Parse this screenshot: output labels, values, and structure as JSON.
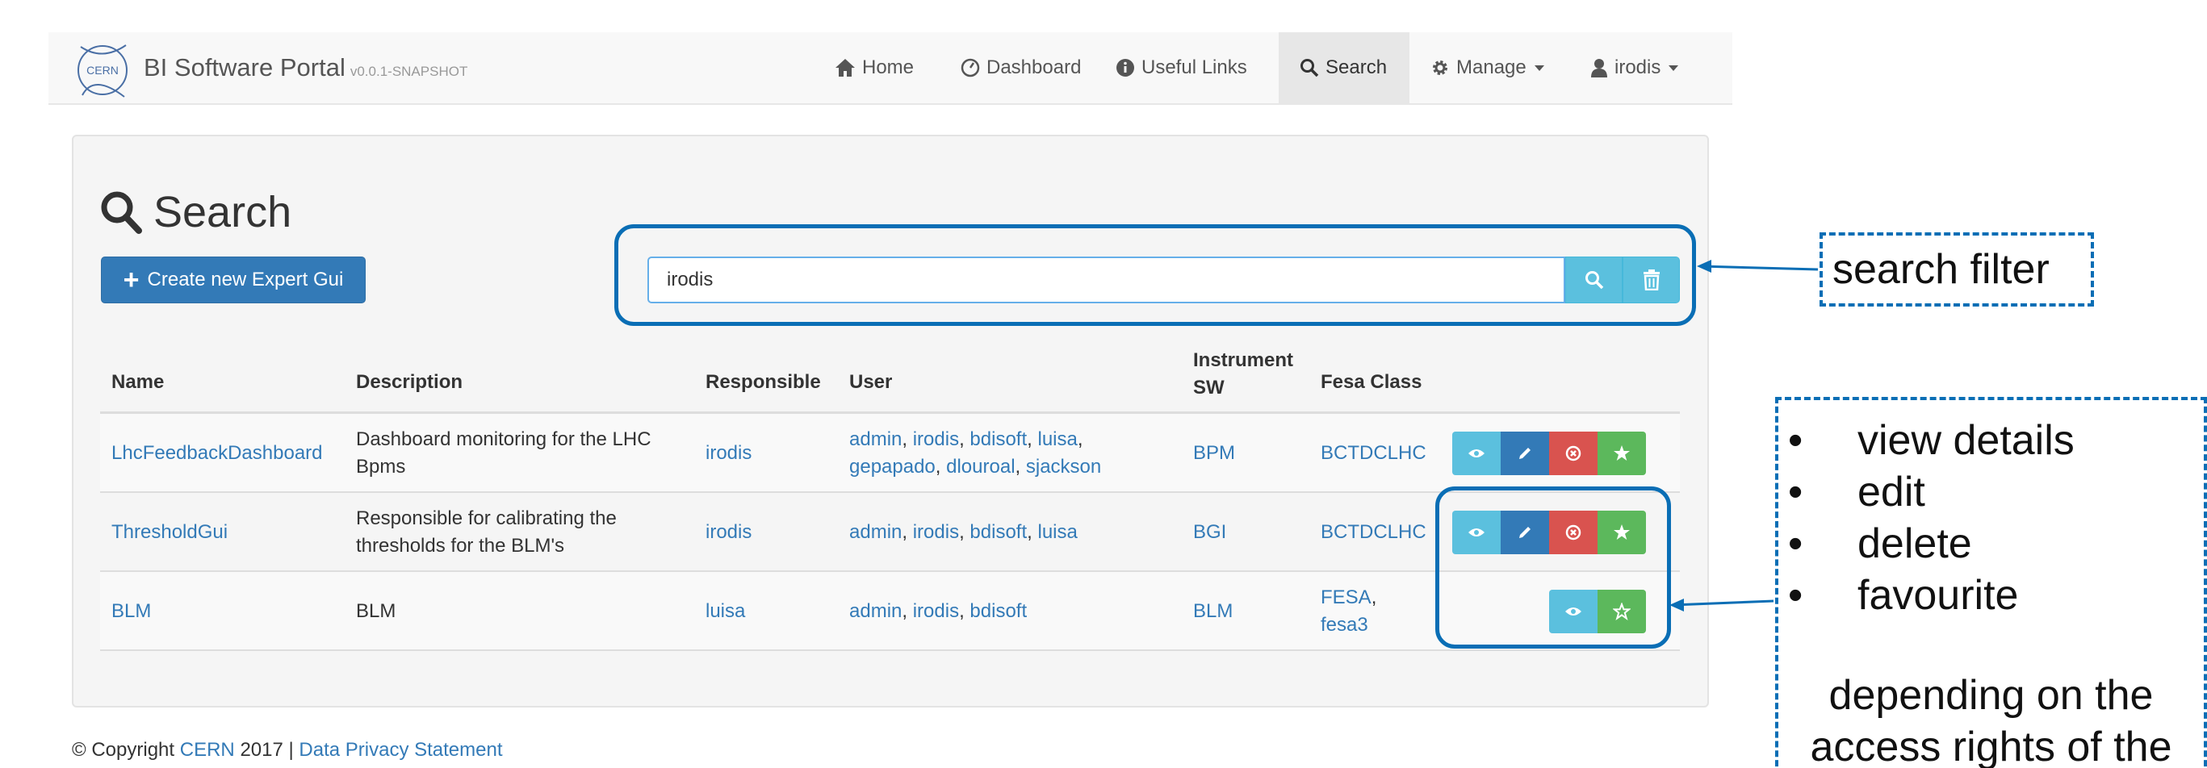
{
  "navbar": {
    "logo_text": "CERN",
    "brand": "BI Software Portal",
    "version": "v0.0.1-SNAPSHOT",
    "items": [
      {
        "label": "Home",
        "icon": "home-icon"
      },
      {
        "label": "Dashboard",
        "icon": "dashboard-icon"
      },
      {
        "label": "Useful Links",
        "icon": "info-icon"
      },
      {
        "label": "Search",
        "icon": "search-icon",
        "active": true
      },
      {
        "label": "Manage",
        "icon": "gear-icon",
        "dropdown": true
      },
      {
        "label": "irodis",
        "icon": "user-icon",
        "dropdown": true
      }
    ]
  },
  "page": {
    "title": "Search",
    "create_button": "Create new Expert Gui",
    "search_value": "irodis"
  },
  "table": {
    "headers": {
      "name": "Name",
      "description": "Description",
      "responsible": "Responsible",
      "user": "User",
      "instrument_line1": "Instrument",
      "instrument_line2": "SW",
      "fesa": "Fesa Class"
    },
    "rows": [
      {
        "name": "LhcFeedbackDashboard",
        "description_line1": "Dashboard monitoring for the LHC",
        "description_line2": "Bpms",
        "responsible": "irodis",
        "users": [
          "admin",
          "irodis",
          "bdisoft",
          "luisa",
          "gepapado",
          "dlouroal",
          "sjackson"
        ],
        "instrument": "BPM",
        "fesa": [
          "BCTDCLHC"
        ],
        "actions": [
          "view",
          "edit",
          "delete",
          "favourite"
        ]
      },
      {
        "name": "ThresholdGui",
        "description_line1": "Responsible for calibrating the",
        "description_line2": "thresholds for the BLM's",
        "responsible": "irodis",
        "users": [
          "admin",
          "irodis",
          "bdisoft",
          "luisa"
        ],
        "instrument": "BGI",
        "fesa": [
          "BCTDCLHC"
        ],
        "actions": [
          "view",
          "edit",
          "delete",
          "favourite"
        ]
      },
      {
        "name": "BLM",
        "description_line1": "BLM",
        "description_line2": "",
        "responsible": "luisa",
        "users": [
          "admin",
          "irodis",
          "bdisoft"
        ],
        "instrument": "BLM",
        "fesa": [
          "FESA",
          "fesa3"
        ],
        "actions": [
          "view",
          "favourite"
        ]
      }
    ]
  },
  "footer": {
    "copyright": "© Copyright",
    "cern": "CERN",
    "year": "2017 |",
    "privacy": "Data Privacy Statement"
  },
  "annotations": {
    "search_filter": "search filter",
    "actions_list": [
      "view details",
      "edit",
      "delete",
      "favourite"
    ],
    "note_line1": "depending on the",
    "note_line2": "access rights of the"
  },
  "colors": {
    "primary": "#337ab7",
    "info": "#5bc0de",
    "danger": "#d9534f",
    "success": "#5cb85c",
    "annotation": "#0a6eb5"
  }
}
